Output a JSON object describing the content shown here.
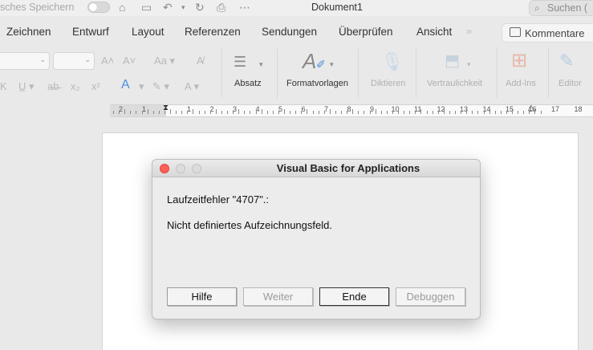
{
  "titlebar": {
    "autosave_label": "sches Speichern",
    "document_title": "Dokument1",
    "search_placeholder": "Suchen ("
  },
  "menu": {
    "tabs": [
      "Zeichnen",
      "Entwurf",
      "Layout",
      "Referenzen",
      "Sendungen",
      "Überprüfen",
      "Ansicht"
    ],
    "more": "»",
    "comments_label": "Kommentare"
  },
  "ribbon": {
    "groups": {
      "paragraph": "Absatz",
      "styles": "Formatvorlagen",
      "dictate": "Diktieren",
      "sensitivity": "Vertraulichkeit",
      "addins": "Add-Ins",
      "editor": "Editor"
    }
  },
  "ruler": {
    "left_numbers": [
      "2",
      "1"
    ],
    "right_numbers": [
      "1",
      "2",
      "3",
      "4",
      "5",
      "6",
      "7",
      "8",
      "9",
      "10",
      "11",
      "12",
      "13",
      "14",
      "15",
      "16",
      "17",
      "18"
    ]
  },
  "dialog": {
    "title": "Visual Basic for Applications",
    "error_line": "Laufzeitfehler \"4707\".:",
    "message": "Nicht definiertes Aufzeichnungsfeld.",
    "buttons": {
      "help": "Hilfe",
      "continue": "Weiter",
      "end": "Ende",
      "debug": "Debuggen"
    }
  },
  "colors": {
    "close_button": "#fe5f57",
    "ribbon_accent": "#4a8fe0"
  }
}
